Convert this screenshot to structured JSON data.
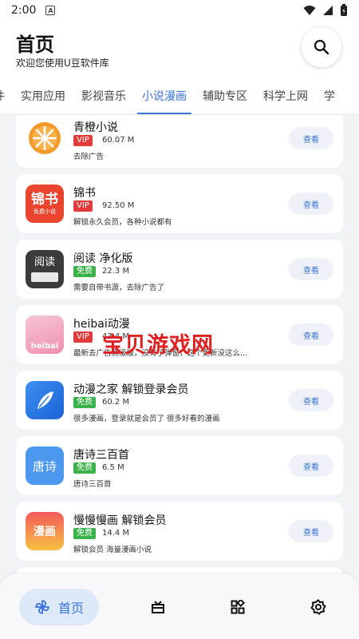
{
  "status": {
    "time": "2:00",
    "notif_letter": "A"
  },
  "header": {
    "title": "首页",
    "subtitle": "欢迎您使用U豆软件库"
  },
  "tabs": [
    {
      "label": "件"
    },
    {
      "label": "实用应用"
    },
    {
      "label": "影视音乐"
    },
    {
      "label": "小说漫画",
      "active": true
    },
    {
      "label": "辅助专区"
    },
    {
      "label": "科学上网"
    },
    {
      "label": "学"
    }
  ],
  "view_label": "查看",
  "apps": [
    {
      "name": "青橙小说",
      "badge": "VIP",
      "size": "60.07 M",
      "desc": "去除广告",
      "icon": "orange-slice-icon"
    },
    {
      "name": "锦书",
      "badge": "VIP",
      "size": "92.50 M",
      "desc": "解锁永久会员，各种小说都有",
      "icon": "jinshu-logo-icon",
      "icon_text": "锦书",
      "icon_sub": "免费小说"
    },
    {
      "name": "阅读 净化版",
      "badge": "免费",
      "size": "22.3 M",
      "desc": "需要自带书源，去除广告了",
      "icon": "yuedu-logo-icon",
      "icon_text": "阅读"
    },
    {
      "name": "heibai动漫",
      "badge": "VIP",
      "size": "43.4 M",
      "desc": "最新去广告高级版，没有了弹窗，这个更新没这么...",
      "icon": "heibai-logo-icon",
      "icon_text": "heibai"
    },
    {
      "name": "动漫之家 解锁登录会员",
      "badge": "免费",
      "size": "60.2 M",
      "desc": "很多漫画，登录就是会员了 很多好看的漫画",
      "icon": "feather-icon"
    },
    {
      "name": "唐诗三百首",
      "badge": "免费",
      "size": "6.5 M",
      "desc": "唐诗三百首",
      "icon": "tangshi-logo-icon",
      "icon_text": "唐诗"
    },
    {
      "name": "慢慢慢画 解锁会员",
      "badge": "免费",
      "size": "14.4 M",
      "desc": "解锁会员 海量漫画小说",
      "icon": "manhua-logo-icon",
      "icon_text": "漫画"
    }
  ],
  "watermark": "宝贝游戏网",
  "nav": {
    "home_label": "首页"
  },
  "colors": {
    "accent": "#3b74d9",
    "vip": "#e23b3b",
    "free": "#3bb34a"
  }
}
